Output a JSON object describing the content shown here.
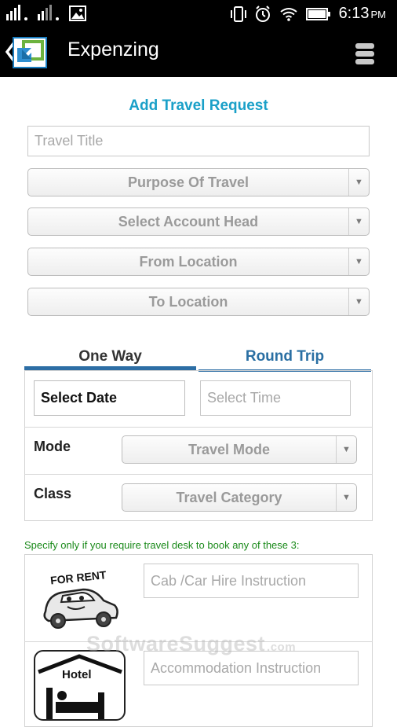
{
  "status_bar": {
    "time": "6:13",
    "ampm": "PM"
  },
  "app_bar": {
    "title": "Expenzing"
  },
  "form": {
    "heading": "Add Travel Request",
    "travel_title_placeholder": "Travel Title",
    "purpose_of_travel": "Purpose Of Travel",
    "account_head": "Select Account Head",
    "from_location": "From Location",
    "to_location": "To Location"
  },
  "tabs": [
    {
      "label": "One Way",
      "selected": true
    },
    {
      "label": "Round Trip",
      "selected": false
    }
  ],
  "trip": {
    "select_date": "Select Date",
    "select_time_placeholder": "Select Time",
    "mode_label": "Mode",
    "mode_value": "Travel Mode",
    "class_label": "Class",
    "class_value": "Travel Category"
  },
  "travel_desk": {
    "note": "Specify only if you require travel desk to book any of these 3:",
    "cab_placeholder": "Cab /Car Hire Instruction",
    "accommodation_placeholder": "Accommodation Instruction",
    "for_rent_text": "FOR RENT",
    "hotel_text": "Hotel"
  },
  "watermark": {
    "text": "SoftwareSuggest",
    "suffix": ".com"
  },
  "colors": {
    "accent": "#1aa0c8",
    "tab_underline": "#2d6ea5",
    "note_green": "#1a8a1a"
  }
}
